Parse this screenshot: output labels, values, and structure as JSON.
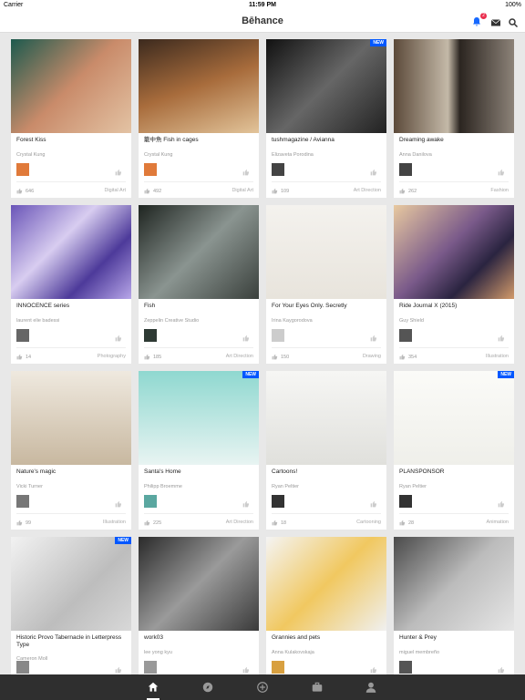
{
  "status_bar": {
    "carrier": "Carrier",
    "time": "11:59 PM",
    "battery": "100%"
  },
  "nav": {
    "logo": "Bēhance",
    "notification_count": "2"
  },
  "projects": [
    {
      "title": "Forest Kiss",
      "owner": "Crystal Kung",
      "appreciations": "646",
      "field": "Digital Art",
      "new": ""
    },
    {
      "title": "籠中魚 Fish in cages",
      "owner": "Crystal Kung",
      "appreciations": "492",
      "field": "Digital Art",
      "new": ""
    },
    {
      "title": "tushmagazine / Avianna",
      "owner": "Elizaveta Porodina",
      "appreciations": "109",
      "field": "Art Direction",
      "new": "NEW"
    },
    {
      "title": "Dreaming awake",
      "owner": "Anna Danilova",
      "appreciations": "262",
      "field": "Fashion",
      "new": ""
    },
    {
      "title": "INNOCENCE series",
      "owner": "laurent elie badessi",
      "appreciations": "14",
      "field": "Photography",
      "new": ""
    },
    {
      "title": "Fish",
      "owner": "Zeppelin Creative Studio",
      "appreciations": "185",
      "field": "Art Direction",
      "new": ""
    },
    {
      "title": "For Your Eyes Only. Secretly",
      "owner": "Irina Kaygorodova",
      "appreciations": "150",
      "field": "Drawing",
      "new": ""
    },
    {
      "title": "Ride Journal X (2015)",
      "owner": "Guy Shield",
      "appreciations": "354",
      "field": "Illustration",
      "new": ""
    },
    {
      "title": "Nature's magic",
      "owner": "Vicki Turner",
      "appreciations": "99",
      "field": "Illustration",
      "new": ""
    },
    {
      "title": "Santa's Home",
      "owner": "Philipp Broemme",
      "appreciations": "225",
      "field": "Art Direction",
      "new": "NEW"
    },
    {
      "title": "Cartoons!",
      "owner": "Ryan Peltier",
      "appreciations": "18",
      "field": "Cartooning",
      "new": ""
    },
    {
      "title": "PLANSPONSOR",
      "owner": "Ryan Peltier",
      "appreciations": "28",
      "field": "Animation",
      "new": "NEW"
    },
    {
      "title": "Historic Provo Tabernacle in Letterpress Type",
      "owner": "Cameron Moll",
      "appreciations": "",
      "field": "",
      "new": "NEW"
    },
    {
      "title": "work03",
      "owner": "lee yong kyu",
      "appreciations": "",
      "field": "",
      "new": ""
    },
    {
      "title": "Grannies and pets",
      "owner": "Anna Kulakovskaja",
      "appreciations": "",
      "field": "",
      "new": ""
    },
    {
      "title": "Hunter & Prey",
      "owner": "miguel membreño",
      "appreciations": "",
      "field": "",
      "new": ""
    }
  ],
  "tabs": [
    {
      "name": "home-tab",
      "icon": "home-icon"
    },
    {
      "name": "discover-tab",
      "icon": "compass-icon"
    },
    {
      "name": "create-tab",
      "icon": "plus-circle-icon"
    },
    {
      "name": "jobs-tab",
      "icon": "briefcase-icon"
    },
    {
      "name": "profile-tab",
      "icon": "person-icon"
    }
  ]
}
